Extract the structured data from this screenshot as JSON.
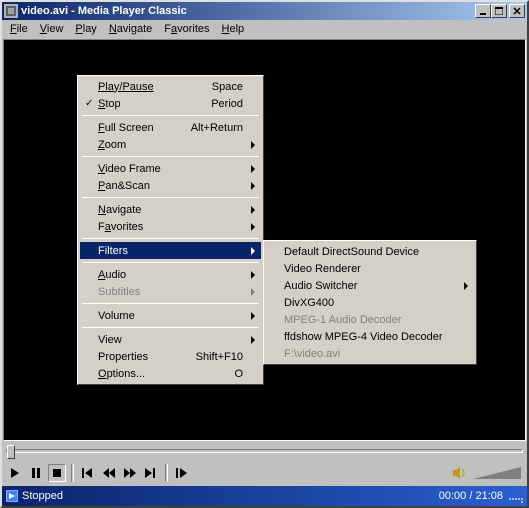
{
  "window": {
    "title": "video.avi - Media Player Classic"
  },
  "menubar": [
    "File",
    "View",
    "Play",
    "Navigate",
    "Favorites",
    "Help"
  ],
  "context_menu": {
    "play_pause": "Play/Pause",
    "play_pause_accel": "Space",
    "stop": "Stop",
    "stop_accel": "Period",
    "fullscreen": "Full Screen",
    "fullscreen_accel": "Alt+Return",
    "zoom": "Zoom",
    "video_frame": "Video Frame",
    "panscan": "Pan&Scan",
    "navigate": "Navigate",
    "favorites": "Favorites",
    "filters": "Filters",
    "audio": "Audio",
    "subtitles": "Subtitles",
    "volume": "Volume",
    "view": "View",
    "properties": "Properties",
    "properties_accel": "Shift+F10",
    "options": "Options...",
    "options_accel": "O"
  },
  "filters_submenu": {
    "default_directsound": "Default DirectSound Device",
    "video_renderer": "Video Renderer",
    "audio_switcher": "Audio Switcher",
    "divx": "DivXG400",
    "mpeg1": "MPEG-1 Audio Decoder",
    "ffdshow": "ffdshow MPEG-4 Video Decoder",
    "source": "F:\\video.avi"
  },
  "status": {
    "state": "Stopped",
    "time": "00:00 / 21:08"
  }
}
